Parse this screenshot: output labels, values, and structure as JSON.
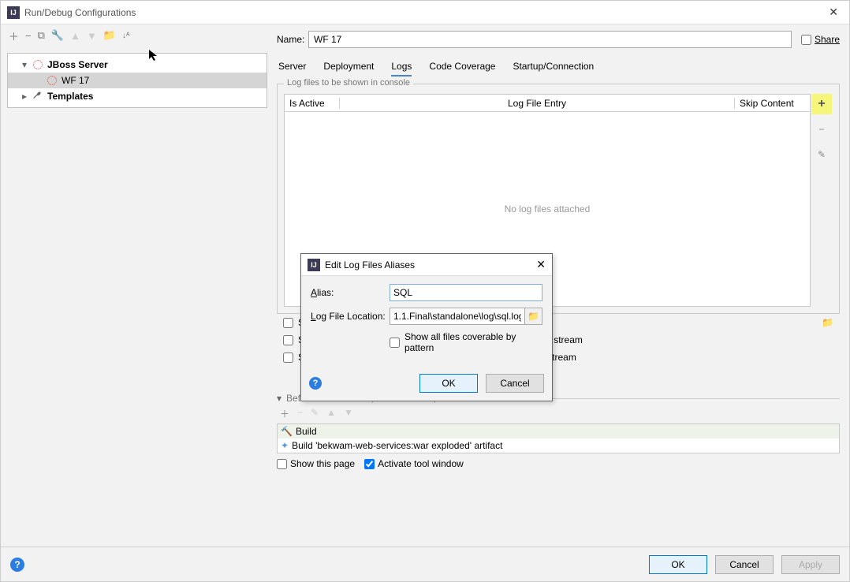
{
  "window": {
    "title": "Run/Debug Configurations"
  },
  "tree": {
    "root1": {
      "label": "JBoss Server"
    },
    "child1": {
      "label": "WF 17"
    },
    "root2": {
      "label": "Templates"
    }
  },
  "name": {
    "label": "Name:",
    "value": "WF 17"
  },
  "share": {
    "label": "Share"
  },
  "tabs": {
    "server": "Server",
    "deployment": "Deployment",
    "logs": "Logs",
    "coverage": "Code Coverage",
    "startup": "Startup/Connection"
  },
  "logs": {
    "legend": "Log files to be shown in console",
    "col_active": "Is Active",
    "col_entry": "Log File Entry",
    "col_skip": "Skip Content",
    "empty": "No log files attached",
    "plus": "+",
    "minus": "−",
    "edit": "✎"
  },
  "checks": {
    "save_partial": "Sa",
    "stdout": "Show console when a message is printed to standard output stream",
    "stderr": "Show console when a message is printed to standard error stream"
  },
  "before": {
    "label": "Before launch: Build, Build Artifacts, Activate tool window",
    "item1": "Build",
    "item2": "Build 'bekwam-web-services:war exploded' artifact"
  },
  "bottom": {
    "show_page": "Show this page",
    "activate": "Activate tool window"
  },
  "footer": {
    "ok": "OK",
    "cancel": "Cancel",
    "apply": "Apply"
  },
  "modal": {
    "title": "Edit Log Files Aliases",
    "alias_label_u": "A",
    "alias_label_rest": "lias:",
    "alias_value": "SQL",
    "loc_label_u": "L",
    "loc_label_rest": "og File Location:",
    "loc_value": "1.1.Final\\standalone\\log\\sql.log",
    "show_all": "Show all files coverable by pattern",
    "ok": "OK",
    "cancel": "Cancel"
  }
}
